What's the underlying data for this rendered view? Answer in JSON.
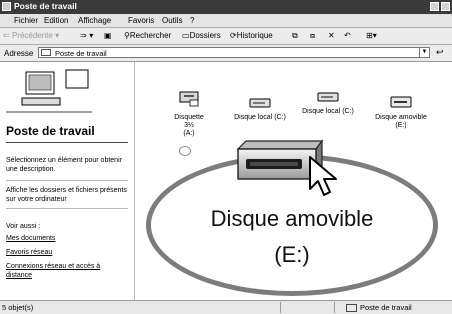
{
  "window": {
    "title": "Poste de travail"
  },
  "menu": {
    "items": [
      "Fichier",
      "Edition",
      "Affichage",
      "Favoris",
      "Outils",
      "?"
    ]
  },
  "toolbar": {
    "back": "Précédente",
    "search": "Rechercher",
    "folders": "Dossiers",
    "history": "Historique"
  },
  "address": {
    "label": "Adresse",
    "value": "Poste de travail"
  },
  "left": {
    "heading": "Poste de travail",
    "description": "Sélectionnez un élément pour obtenir une description.",
    "info": "Affiche les dossiers et fichiers présents sur votre ordinateur",
    "see_also": "Voir aussi :",
    "links": [
      "Mes documents",
      "Favoris réseau",
      "Connexions réseau et accès à distance"
    ]
  },
  "items": [
    {
      "name": "Disquette 3½",
      "drive": "(A:)",
      "icon": "floppy-drive-icon"
    },
    {
      "name": "Disque local (C:)",
      "drive": "",
      "icon": "hard-disk-icon"
    },
    {
      "name": "Disque local (C:)",
      "drive": "",
      "icon": "hard-disk-icon"
    },
    {
      "name": "Disque amovible",
      "drive": "(E:)",
      "icon": "removable-disk-icon"
    }
  ],
  "zoom": {
    "line1": "Disque amovible",
    "line2": "(E:)"
  },
  "status": {
    "count": "5 objet(s)",
    "location": "Poste de travail"
  }
}
